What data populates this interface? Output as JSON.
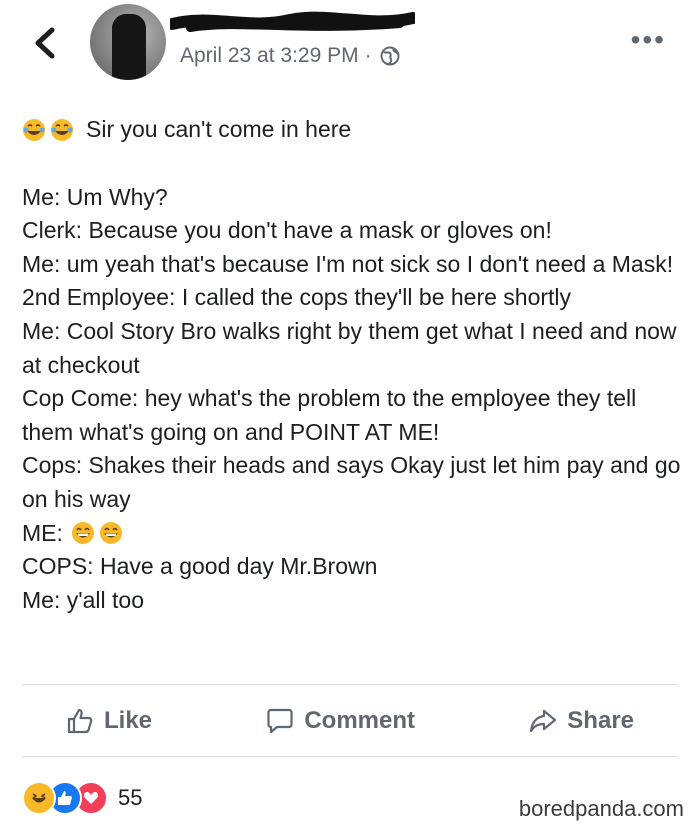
{
  "header": {
    "timestamp": "April 23 at 3:29 PM",
    "separator": "·",
    "more": "•••",
    "privacy_icon": "globe-icon",
    "back_icon": "chevron-left-icon"
  },
  "post": {
    "lines": [
      "Sir you can't come in here",
      "Me: Um Why?",
      "Clerk: Because you don't have a mask or gloves on!",
      "Me: um yeah that's because I'm not sick so I don't need a Mask!",
      "2nd Employee: I called the cops they'll be here shortly",
      "Me: Cool Story Bro walks right by them get what I need and now at checkout",
      "Cop Come: hey what's the problem to the employee they tell them what's going on and POINT AT ME!",
      "Cops:  Shakes their heads and says Okay just let him pay and go on his way",
      "ME:",
      "COPS: Have a good day Mr.Brown",
      "Me: y'all too"
    ]
  },
  "actions": {
    "like": "Like",
    "comment": "Comment",
    "share": "Share"
  },
  "reactions": {
    "count": "55",
    "types": [
      "haha",
      "like",
      "love"
    ]
  },
  "watermark": "boredpanda.com",
  "colors": {
    "meta_text": "#606770",
    "like_blue": "#1877f2",
    "love_red": "#f33e58",
    "haha_yellow": "#f7b928"
  }
}
